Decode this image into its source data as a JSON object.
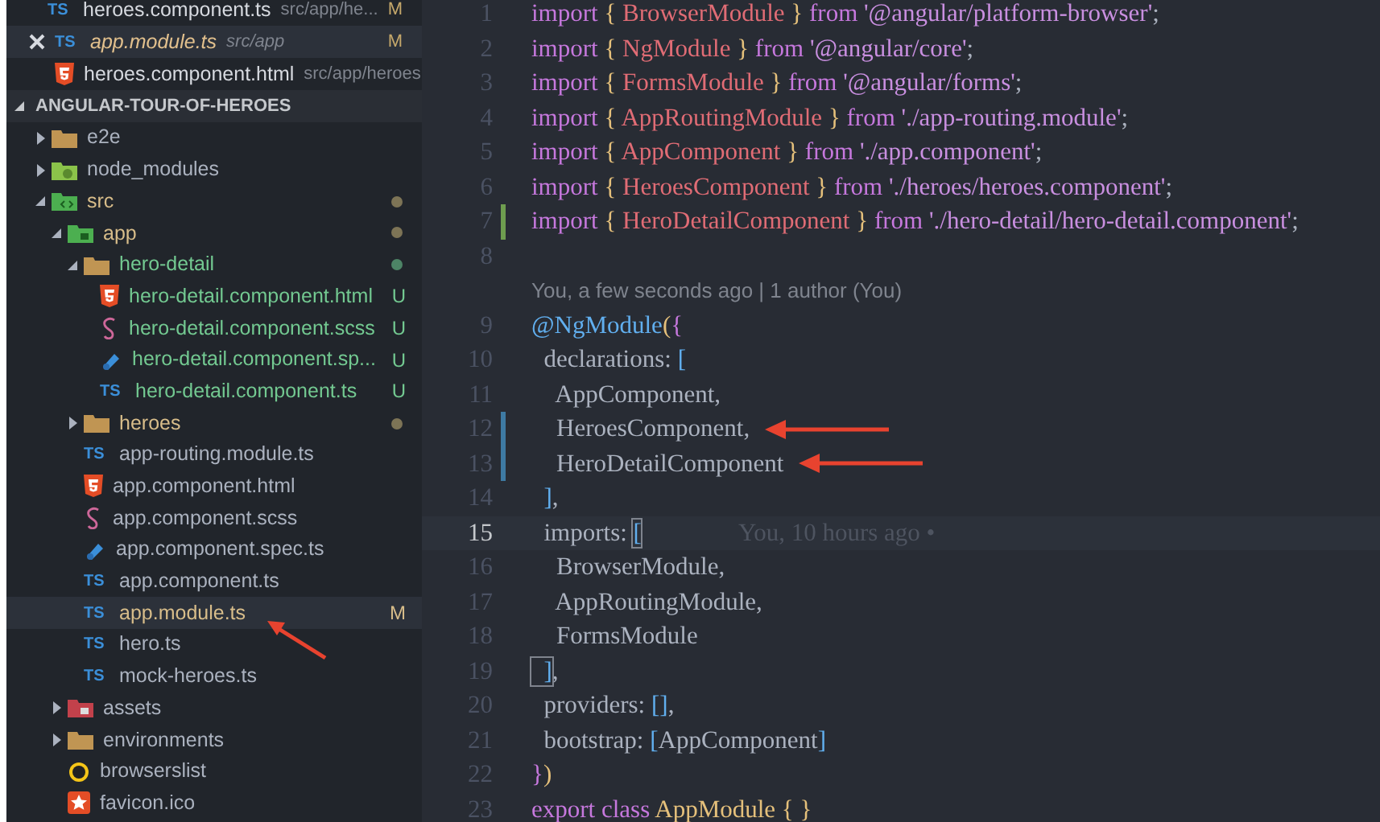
{
  "open_editors": [
    {
      "name": "heroes.component.ts",
      "path": "src/app/he...",
      "kind": "ts",
      "icon_text": "TS",
      "badge": "M",
      "active": false,
      "preview": false
    },
    {
      "name": "app.module.ts",
      "path": "src/app",
      "kind": "ts",
      "icon_text": "TS",
      "badge": "M",
      "active": true,
      "preview": true
    },
    {
      "name": "heroes.component.html",
      "path": "src/app/heroes",
      "kind": "html",
      "active": false,
      "preview": false
    }
  ],
  "explorer": {
    "title": "ANGULAR-TOUR-OF-HEROES",
    "expanded": true,
    "items": [
      {
        "name": "e2e",
        "kind": "folder",
        "expanded": false,
        "modified": false,
        "untracked": false,
        "selected": false,
        "arrow": false
      },
      {
        "name": "node_modules",
        "kind": "node",
        "expanded": false,
        "modified": false,
        "untracked": false,
        "selected": false,
        "arrow": false
      },
      {
        "name": "src",
        "kind": "src",
        "expanded": true,
        "modified": true,
        "untracked": false,
        "dot": true,
        "selected": false,
        "arrow": false,
        "children": [
          {
            "name": "app",
            "kind": "app",
            "expanded": true,
            "modified": true,
            "untracked": false,
            "dot": true,
            "selected": false,
            "arrow": false,
            "children": [
              {
                "name": "hero-detail",
                "kind": "folder",
                "expanded": true,
                "modified": false,
                "untracked": true,
                "dot": true,
                "selected": false,
                "arrow": false,
                "children": [
                  {
                    "name": "hero-detail.component.html",
                    "kind": "html",
                    "modified": false,
                    "untracked": true,
                    "badge": "U",
                    "selected": false,
                    "arrow": false
                  },
                  {
                    "name": "hero-detail.component.scss",
                    "kind": "scss",
                    "modified": false,
                    "untracked": true,
                    "badge": "U",
                    "selected": false,
                    "arrow": false
                  },
                  {
                    "name": "hero-detail.component.sp...",
                    "kind": "spec",
                    "modified": false,
                    "untracked": true,
                    "badge": "U",
                    "selected": false,
                    "arrow": false
                  },
                  {
                    "name": "hero-detail.component.ts",
                    "kind": "ts",
                    "icon_text": "TS",
                    "modified": false,
                    "untracked": true,
                    "badge": "U",
                    "selected": false,
                    "arrow": false
                  }
                ]
              },
              {
                "name": "heroes",
                "kind": "folder",
                "expanded": false,
                "modified": true,
                "untracked": false,
                "dot": true,
                "selected": false,
                "arrow": false
              },
              {
                "name": "app-routing.module.ts",
                "kind": "ts",
                "icon_text": "TS",
                "modified": false,
                "untracked": false,
                "selected": false,
                "arrow": false
              },
              {
                "name": "app.component.html",
                "kind": "html",
                "modified": false,
                "untracked": false,
                "selected": false,
                "arrow": false
              },
              {
                "name": "app.component.scss",
                "kind": "scss",
                "modified": false,
                "untracked": false,
                "selected": false,
                "arrow": false
              },
              {
                "name": "app.component.spec.ts",
                "kind": "spec",
                "modified": false,
                "untracked": false,
                "selected": false,
                "arrow": false
              },
              {
                "name": "app.component.ts",
                "kind": "ts",
                "icon_text": "TS",
                "modified": false,
                "untracked": false,
                "selected": false,
                "arrow": false
              },
              {
                "name": "app.module.ts",
                "kind": "ts",
                "icon_text": "TS",
                "modified": true,
                "untracked": false,
                "badge": "M",
                "selected": true,
                "arrow": true
              },
              {
                "name": "hero.ts",
                "kind": "ts",
                "icon_text": "TS",
                "modified": false,
                "untracked": false,
                "selected": false,
                "arrow": false
              },
              {
                "name": "mock-heroes.ts",
                "kind": "ts",
                "icon_text": "TS",
                "modified": false,
                "untracked": false,
                "selected": false,
                "arrow": false
              }
            ]
          },
          {
            "name": "assets",
            "kind": "assets",
            "expanded": false,
            "modified": false,
            "untracked": false,
            "selected": false,
            "arrow": false
          },
          {
            "name": "environments",
            "kind": "folder",
            "expanded": false,
            "modified": false,
            "untracked": false,
            "selected": false,
            "arrow": false
          },
          {
            "name": "browserslist",
            "kind": "ring",
            "modified": false,
            "untracked": false,
            "selected": false,
            "arrow": false
          },
          {
            "name": "favicon.ico",
            "kind": "star",
            "modified": false,
            "untracked": false,
            "selected": false,
            "arrow": false
          }
        ]
      }
    ]
  },
  "editor": {
    "lines": [
      {
        "kind": "code",
        "number": "1",
        "added": false,
        "changed": false,
        "current": false,
        "arrow": false,
        "tokens": [
          {
            "text": "import ",
            "kind": "kw"
          },
          {
            "text": "{ ",
            "kind": "brace"
          },
          {
            "text": "BrowserModule",
            "kind": "id"
          },
          {
            "text": " } ",
            "kind": "brace"
          },
          {
            "text": "from ",
            "kind": "kw"
          },
          {
            "text": "'@angular/platform-browser'",
            "kind": "str"
          },
          {
            "text": ";",
            "kind": "plain"
          }
        ]
      },
      {
        "kind": "code",
        "number": "2",
        "added": false,
        "changed": false,
        "current": false,
        "arrow": false,
        "tokens": [
          {
            "text": "import ",
            "kind": "kw"
          },
          {
            "text": "{ ",
            "kind": "brace"
          },
          {
            "text": "NgModule",
            "kind": "id"
          },
          {
            "text": " } ",
            "kind": "brace"
          },
          {
            "text": "from ",
            "kind": "kw"
          },
          {
            "text": "'@angular/core'",
            "kind": "str"
          },
          {
            "text": ";",
            "kind": "plain"
          }
        ]
      },
      {
        "kind": "code",
        "number": "3",
        "added": false,
        "changed": false,
        "current": false,
        "arrow": false,
        "tokens": [
          {
            "text": "import ",
            "kind": "kw"
          },
          {
            "text": "{ ",
            "kind": "brace"
          },
          {
            "text": "FormsModule",
            "kind": "id"
          },
          {
            "text": " } ",
            "kind": "brace"
          },
          {
            "text": "from ",
            "kind": "kw"
          },
          {
            "text": "'@angular/forms'",
            "kind": "str"
          },
          {
            "text": ";",
            "kind": "plain"
          }
        ]
      },
      {
        "kind": "code",
        "number": "4",
        "added": false,
        "changed": false,
        "current": false,
        "arrow": false,
        "tokens": [
          {
            "text": "import ",
            "kind": "kw"
          },
          {
            "text": "{ ",
            "kind": "brace"
          },
          {
            "text": "AppRoutingModule",
            "kind": "id"
          },
          {
            "text": " } ",
            "kind": "brace"
          },
          {
            "text": "from ",
            "kind": "kw"
          },
          {
            "text": "'./app-routing.module'",
            "kind": "str"
          },
          {
            "text": ";",
            "kind": "plain"
          }
        ]
      },
      {
        "kind": "code",
        "number": "5",
        "added": false,
        "changed": false,
        "current": false,
        "arrow": false,
        "tokens": [
          {
            "text": "import ",
            "kind": "kw"
          },
          {
            "text": "{ ",
            "kind": "brace"
          },
          {
            "text": "AppComponent",
            "kind": "id"
          },
          {
            "text": " } ",
            "kind": "brace"
          },
          {
            "text": "from ",
            "kind": "kw"
          },
          {
            "text": "'./app.component'",
            "kind": "str"
          },
          {
            "text": ";",
            "kind": "plain"
          }
        ]
      },
      {
        "kind": "code",
        "number": "6",
        "added": false,
        "changed": false,
        "current": false,
        "arrow": false,
        "tokens": [
          {
            "text": "import ",
            "kind": "kw"
          },
          {
            "text": "{ ",
            "kind": "brace"
          },
          {
            "text": "HeroesComponent",
            "kind": "id"
          },
          {
            "text": " } ",
            "kind": "brace"
          },
          {
            "text": "from ",
            "kind": "kw"
          },
          {
            "text": "'./heroes/heroes.component'",
            "kind": "str"
          },
          {
            "text": ";",
            "kind": "plain"
          }
        ]
      },
      {
        "kind": "code",
        "number": "7",
        "added": true,
        "changed": false,
        "current": false,
        "arrow": false,
        "tokens": [
          {
            "text": "import ",
            "kind": "kw"
          },
          {
            "text": "{ ",
            "kind": "brace"
          },
          {
            "text": "HeroDetailComponent",
            "kind": "id"
          },
          {
            "text": " } ",
            "kind": "brace"
          },
          {
            "text": "from ",
            "kind": "kw"
          },
          {
            "text": "'./hero-detail/hero-detail.component'",
            "kind": "str"
          },
          {
            "text": ";",
            "kind": "plain"
          }
        ]
      },
      {
        "kind": "code",
        "number": "8",
        "added": false,
        "changed": false,
        "current": false,
        "arrow": false
      },
      {
        "kind": "blame",
        "text": "You, a few seconds ago | 1 author (You)"
      },
      {
        "kind": "code",
        "number": "9",
        "added": false,
        "changed": false,
        "current": false,
        "arrow": false,
        "tokens": [
          {
            "text": "@NgModule",
            "kind": "deco"
          },
          {
            "text": "(",
            "kind": "brace"
          },
          {
            "text": "{",
            "kind": "kw"
          }
        ]
      },
      {
        "kind": "code",
        "number": "10",
        "added": false,
        "changed": false,
        "current": false,
        "arrow": false,
        "tokens": [
          {
            "text": "  declarations: ",
            "kind": "plain"
          },
          {
            "text": "[",
            "kind": "bracket"
          }
        ]
      },
      {
        "kind": "code",
        "number": "11",
        "added": false,
        "changed": false,
        "current": false,
        "arrow": false,
        "tokens": [
          {
            "text": "    AppComponent,",
            "kind": "plain"
          }
        ]
      },
      {
        "kind": "code",
        "number": "12",
        "added": false,
        "changed": true,
        "current": false,
        "arrow": true,
        "tokens": [
          {
            "text": "    HeroesComponent,",
            "kind": "plain"
          }
        ]
      },
      {
        "kind": "code",
        "number": "13",
        "added": false,
        "changed": true,
        "current": false,
        "arrow": true,
        "tokens": [
          {
            "text": "    HeroDetailComponent",
            "kind": "plain"
          }
        ]
      },
      {
        "kind": "code",
        "number": "14",
        "added": false,
        "changed": false,
        "current": false,
        "arrow": false,
        "tokens": [
          {
            "text": "  ]",
            "kind": "bracket"
          },
          {
            "text": ",",
            "kind": "plain"
          }
        ]
      },
      {
        "kind": "code",
        "number": "15",
        "added": false,
        "changed": false,
        "current": true,
        "arrow": false,
        "blame": "You, 10 hours ago •",
        "tokens": [
          {
            "text": "  imports: ",
            "kind": "plain"
          },
          {
            "text": "[",
            "kind": "match"
          }
        ]
      },
      {
        "kind": "code",
        "number": "16",
        "added": false,
        "changed": false,
        "current": false,
        "arrow": false,
        "tokens": [
          {
            "text": "    BrowserModule,",
            "kind": "plain"
          }
        ]
      },
      {
        "kind": "code",
        "number": "17",
        "added": false,
        "changed": false,
        "current": false,
        "arrow": false,
        "tokens": [
          {
            "text": "    AppRoutingModule,",
            "kind": "plain"
          }
        ]
      },
      {
        "kind": "code",
        "number": "18",
        "added": false,
        "changed": false,
        "current": false,
        "arrow": false,
        "tokens": [
          {
            "text": "    FormsModule",
            "kind": "plain"
          }
        ]
      },
      {
        "kind": "code",
        "number": "19",
        "added": false,
        "changed": false,
        "current": false,
        "arrow": false,
        "tokens": [
          {
            "text": "  ]",
            "kind": "match"
          },
          {
            "text": ",",
            "kind": "plain"
          }
        ]
      },
      {
        "kind": "code",
        "number": "20",
        "added": false,
        "changed": false,
        "current": false,
        "arrow": false,
        "tokens": [
          {
            "text": "  providers: ",
            "kind": "plain"
          },
          {
            "text": "[]",
            "kind": "bracket"
          },
          {
            "text": ",",
            "kind": "plain"
          }
        ]
      },
      {
        "kind": "code",
        "number": "21",
        "added": false,
        "changed": false,
        "current": false,
        "arrow": false,
        "tokens": [
          {
            "text": "  bootstrap: ",
            "kind": "plain"
          },
          {
            "text": "[",
            "kind": "bracket"
          },
          {
            "text": "AppComponent",
            "kind": "plain"
          },
          {
            "text": "]",
            "kind": "bracket"
          }
        ]
      },
      {
        "kind": "code",
        "number": "22",
        "added": false,
        "changed": false,
        "current": false,
        "arrow": false,
        "tokens": [
          {
            "text": "}",
            "kind": "kw"
          },
          {
            "text": ")",
            "kind": "brace"
          }
        ]
      },
      {
        "kind": "code",
        "number": "23",
        "added": false,
        "changed": false,
        "current": false,
        "arrow": false,
        "tokens": [
          {
            "text": "export class ",
            "kind": "kw"
          },
          {
            "text": "AppModule",
            "kind": "cls"
          },
          {
            "text": " { }",
            "kind": "brace"
          }
        ]
      }
    ]
  }
}
